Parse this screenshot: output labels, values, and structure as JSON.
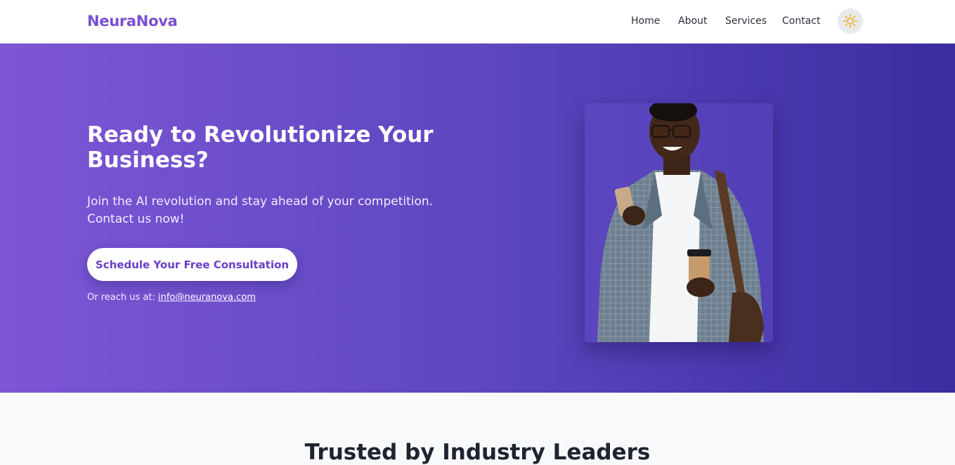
{
  "brand": {
    "name": "NeuraNova",
    "color": "#7b4fd0"
  },
  "nav": {
    "links": [
      {
        "label": "Home"
      },
      {
        "label": "About"
      },
      {
        "label": "Services"
      },
      {
        "label": "Contact"
      }
    ],
    "theme_toggle_icon": "sun-icon"
  },
  "hero": {
    "title": "Ready to Revolutionize Your Business?",
    "subtitle": "Join the AI revolution and stay ahead of your competition. Contact us now!",
    "cta_label": "Schedule Your Free Consultation",
    "reach_prefix": "Or reach us at:",
    "email": "info@neuranova.com",
    "gradient": [
      "#7d56d6",
      "#3a2da0"
    ]
  },
  "trusted": {
    "title": "Trusted by Industry Leaders"
  }
}
